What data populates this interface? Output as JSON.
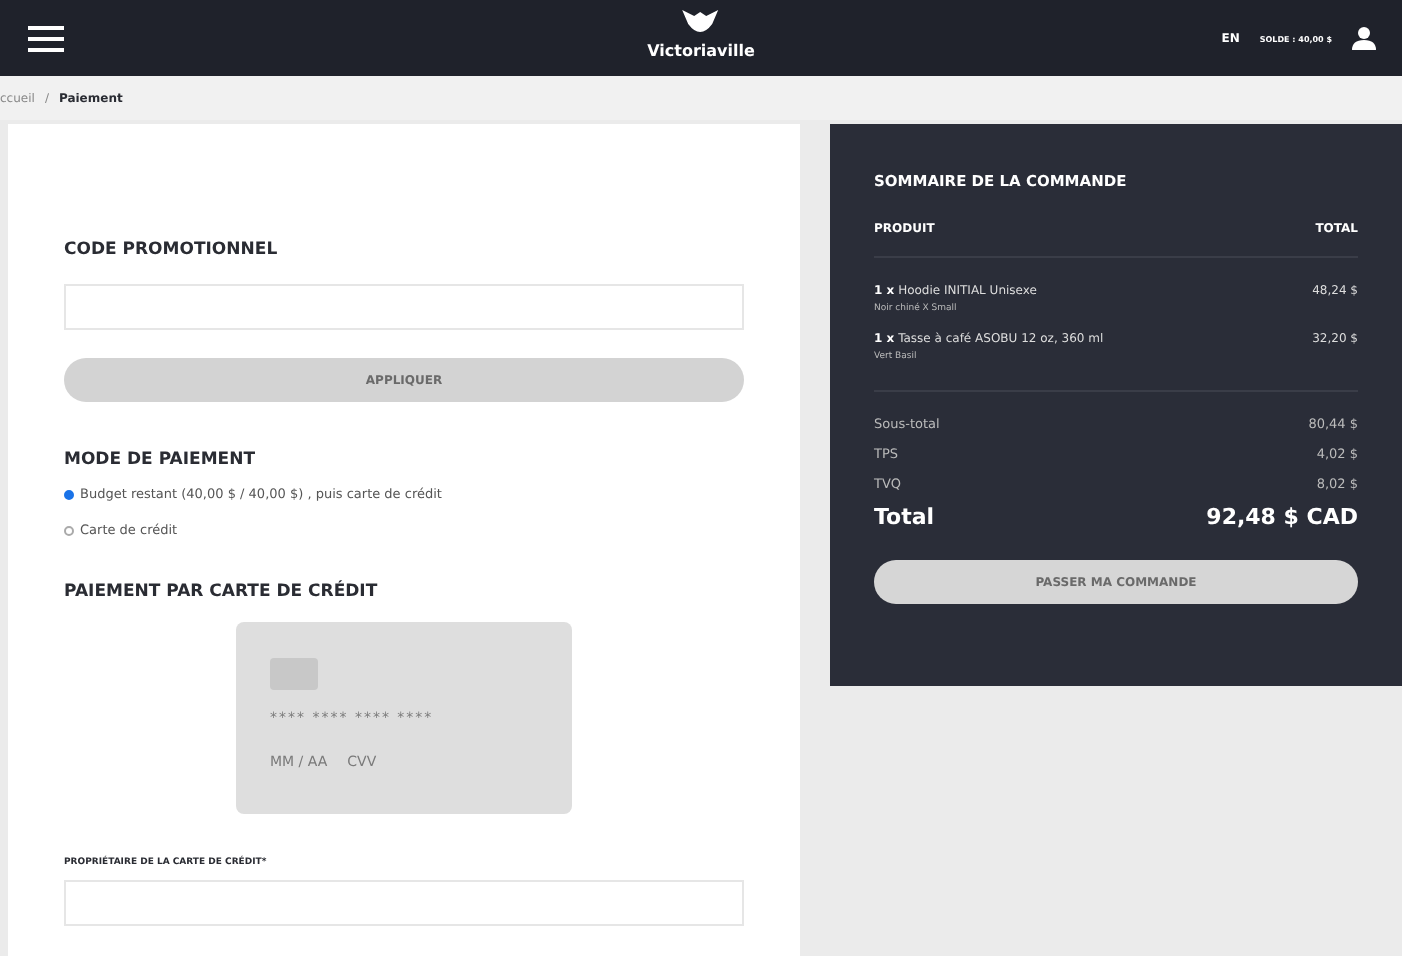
{
  "header": {
    "brand": "Victoriaville",
    "language": "EN",
    "balance": "SOLDE : 40,00 $"
  },
  "breadcrumb": [
    "ccueil",
    "/",
    "Paiement"
  ],
  "promo": {
    "title": "CODE PROMOTIONNEL",
    "button": "APPLIQUER"
  },
  "payment_mode": {
    "title": "MODE DE PAIEMENT",
    "options": [
      {
        "label": "Budget restant (40,00 $ / 40,00 $) , puis carte de crédit",
        "selected": true
      },
      {
        "label": "Carte de crédit",
        "selected": false
      }
    ]
  },
  "card_payment": {
    "title": "PAIEMENT PAR CARTE DE CRÉDIT",
    "card_number": "**** **** **** ****",
    "card_expiry": "MM / AA",
    "card_cvv": "CVV",
    "owner_label": "PROPRIÉTAIRE DE LA CARTE DE CRÉDIT*"
  },
  "summary": {
    "title": "SOMMAIRE DE LA COMMANDE",
    "columns": [
      "PRODUIT",
      "TOTAL"
    ],
    "items": [
      {
        "qty": "1 x",
        "name": "Hoodie INITIAL Unisexe",
        "variant": "Noir chiné X Small",
        "total": "48,24 $"
      },
      {
        "qty": "1 x",
        "name": "Tasse à café ASOBU 12 oz, 360 ml",
        "variant": "Vert Basil",
        "total": "32,20 $"
      }
    ],
    "lines": [
      {
        "label": "Sous-total",
        "value": "80,44 $"
      },
      {
        "label": "TPS",
        "value": "4,02 $"
      },
      {
        "label": "TVQ",
        "value": "8,02 $"
      }
    ],
    "total_label": "Total",
    "total_value": "92,48 $ CAD",
    "button": "PASSER MA COMMANDE"
  }
}
